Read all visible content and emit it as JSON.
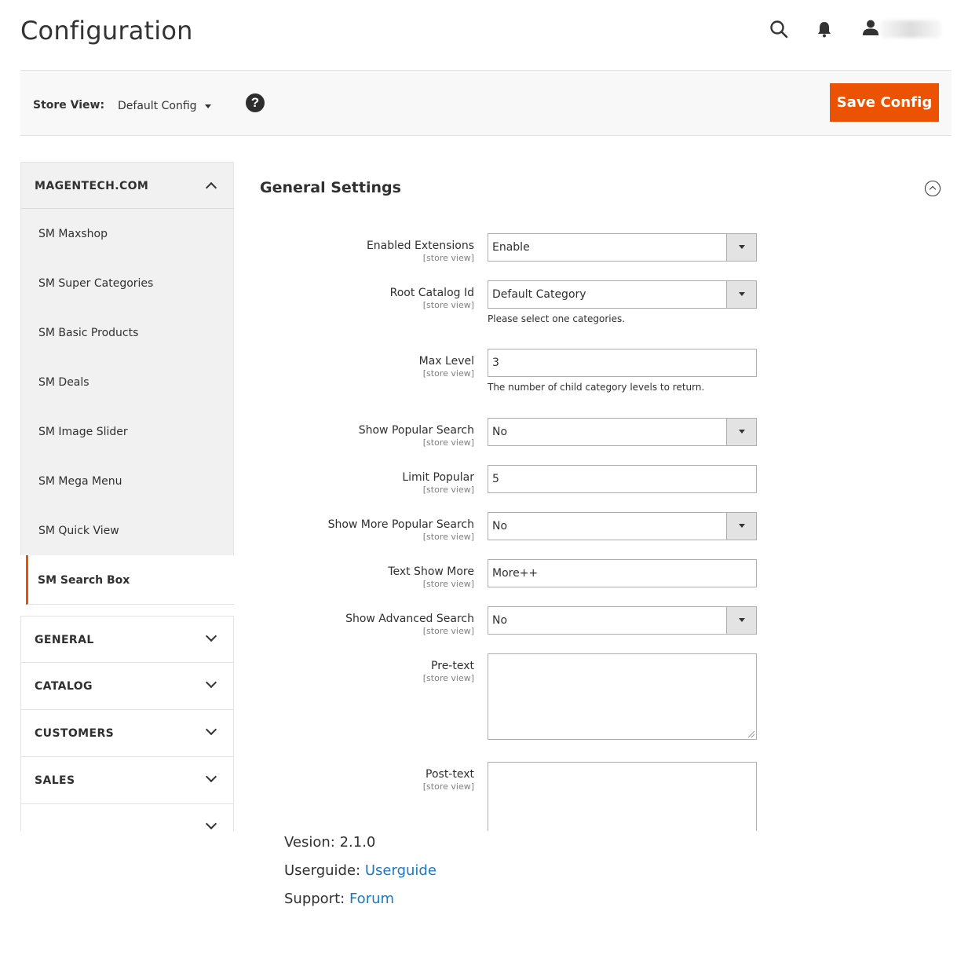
{
  "header": {
    "title": "Configuration",
    "icons": [
      "search-icon",
      "bell-icon",
      "user-icon"
    ]
  },
  "store_bar": {
    "label": "Store View:",
    "selected": "Default Config",
    "save_label": "Save Config"
  },
  "sidebar": {
    "section_open": "MAGENTECH.COM",
    "items": [
      {
        "label": "SM Maxshop"
      },
      {
        "label": "SM Super Categories"
      },
      {
        "label": "SM Basic Products"
      },
      {
        "label": "SM Deals"
      },
      {
        "label": "SM Image Slider"
      },
      {
        "label": "SM Mega Menu"
      },
      {
        "label": "SM Quick View"
      },
      {
        "label": "SM Search Box"
      }
    ],
    "sections": [
      {
        "label": "GENERAL"
      },
      {
        "label": "CATALOG"
      },
      {
        "label": "CUSTOMERS"
      },
      {
        "label": "SALES"
      }
    ]
  },
  "main": {
    "group_title": "General Settings",
    "scope": "[store view]",
    "fields": {
      "enabled_extensions": {
        "label": "Enabled Extensions",
        "value": "Enable"
      },
      "root_catalog": {
        "label": "Root Catalog Id",
        "value": "Default Category",
        "note": "Please select one categories."
      },
      "max_level": {
        "label": "Max Level",
        "value": "3",
        "note": "The number of child category levels to return."
      },
      "show_popular": {
        "label": "Show Popular Search",
        "value": "No"
      },
      "limit_popular": {
        "label": "Limit Popular",
        "value": "5"
      },
      "show_more_popular": {
        "label": "Show More Popular Search",
        "value": "No"
      },
      "text_show_more": {
        "label": "Text Show More",
        "value": "More++"
      },
      "show_advanced": {
        "label": "Show Advanced Search",
        "value": "No"
      },
      "pre_text": {
        "label": "Pre-text",
        "value": ""
      },
      "post_text": {
        "label": "Post-text",
        "value": ""
      }
    }
  },
  "info": {
    "version_label": "Vesion: 2.1.0",
    "userguide_label": "Userguide:",
    "userguide_link": "Userguide",
    "support_label": "Support:",
    "support_link": "Forum"
  },
  "colors": {
    "accent": "#eb5202",
    "link": "#1979c3"
  }
}
